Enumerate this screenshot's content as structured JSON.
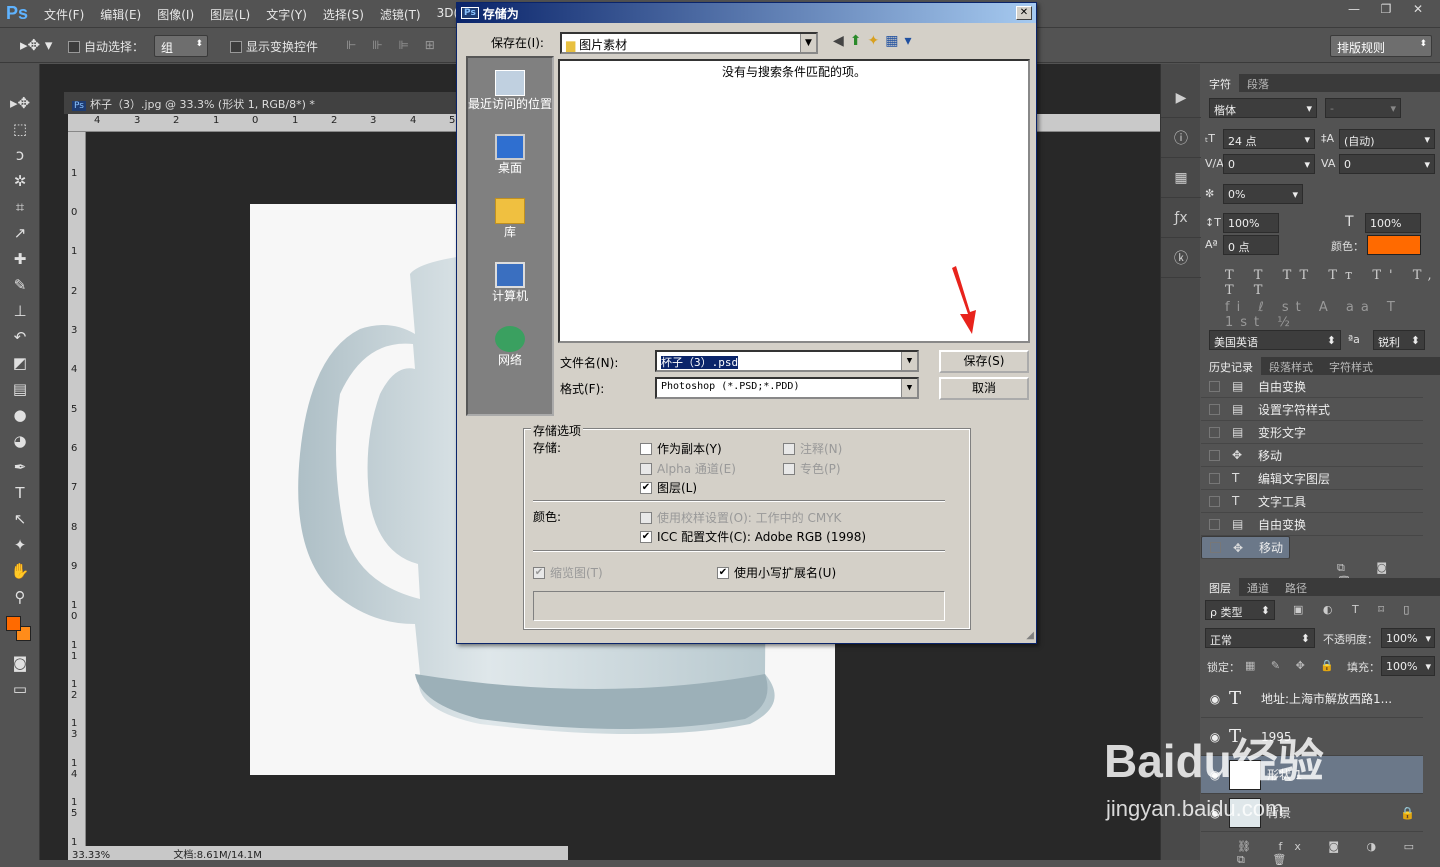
{
  "app": {
    "logo": "Ps",
    "menu": [
      "文件(F)",
      "编辑(E)",
      "图像(I)",
      "图层(L)",
      "文字(Y)",
      "选择(S)",
      "滤镜(T)",
      "3D(D"
    ],
    "window_buttons": [
      "—",
      "❐",
      "✕"
    ]
  },
  "options": {
    "auto_select_label": "自动选择：",
    "auto_select_value": "组",
    "show_transform_label": "显示变换控件",
    "right_select": "排版规则"
  },
  "document": {
    "tab_title": "杯子（3）.jpg @ 33.3% (形状 1, RGB/8*) *",
    "ruler_h": [
      "4",
      "3",
      "2",
      "1",
      "0",
      "1",
      "2",
      "3",
      "4",
      "5"
    ],
    "ruler_v": [
      "1",
      "0",
      "1",
      "2",
      "3",
      "4",
      "5",
      "6",
      "7",
      "8",
      "9",
      "1 0",
      "1 1",
      "1 2",
      "1 3",
      "1 4",
      "1 5",
      "1"
    ],
    "zoom": "33.33%",
    "doc_size": "文档:8.61M/14.1M"
  },
  "character_panel": {
    "tabs": [
      "字符",
      "段落"
    ],
    "font_family": "楷体",
    "font_style": "-",
    "font_size": "24 点",
    "leading": "(自动)",
    "kerning": "0",
    "tracking": "0",
    "scale_ratio": "0%",
    "vertical_scale": "100%",
    "horizontal_scale": "100%",
    "baseline": "0 点",
    "color_label": "颜色：",
    "color": "#ff6a00",
    "language": "美国英语",
    "aa_label": "ªa",
    "antialias": "锐利"
  },
  "history_panel": {
    "tabs": [
      "历史记录",
      "段落样式",
      "字符样式"
    ],
    "items": [
      {
        "icon": "▤",
        "label": "自由变换"
      },
      {
        "icon": "▤",
        "label": "设置字符样式"
      },
      {
        "icon": "▤",
        "label": "变形文字"
      },
      {
        "icon": "✥",
        "label": "移动"
      },
      {
        "icon": "T",
        "label": "编辑文字图层"
      },
      {
        "icon": "T",
        "label": "文字工具"
      },
      {
        "icon": "▤",
        "label": "自由变换"
      },
      {
        "icon": "✥",
        "label": "移动"
      }
    ]
  },
  "layers_panel": {
    "tabs": [
      "图层",
      "通道",
      "路径"
    ],
    "kind": "ρ 类型",
    "blend_mode": "正常",
    "opacity_label": "不透明度：",
    "opacity": "100%",
    "lock_label": "锁定：",
    "fill_label": "填充：",
    "fill": "100%",
    "layers": [
      {
        "name": "地址:上海市解放西路1...",
        "type": "text"
      },
      {
        "name": "1995",
        "type": "text"
      },
      {
        "name": "形状 1",
        "type": "shape"
      },
      {
        "name": "背景",
        "type": "bg"
      }
    ]
  },
  "dialog": {
    "title": "存储为",
    "save_in_label": "保存在(I):",
    "save_in_value": "图片素材",
    "empty_message": "没有与搜索条件匹配的项。",
    "places": [
      "最近访问的位置",
      "桌面",
      "库",
      "计算机",
      "网络"
    ],
    "filename_label": "文件名(N):",
    "filename_value": "杯子（3）.psd",
    "format_label": "格式(F):",
    "format_value": "Photoshop (*.PSD;*.PDD)",
    "save_button": "保存(S)",
    "cancel_button": "取消",
    "options_title": "存储选项",
    "store_label": "存储:",
    "as_copy": "作为副本(Y)",
    "notes": "注释(N)",
    "alpha": "Alpha 通道(E)",
    "spot": "专色(P)",
    "layers": "图层(L)",
    "color_label": "颜色:",
    "use_proof": "使用校样设置(O):  工作中的 CMYK",
    "icc": "ICC 配置文件(C):  Adobe RGB (1998)",
    "thumbnail": "缩览图(T)",
    "lowercase_ext": "使用小写扩展名(U)"
  },
  "watermark": {
    "brand": "Baidu经验",
    "url": "jingyan.baidu.com"
  }
}
